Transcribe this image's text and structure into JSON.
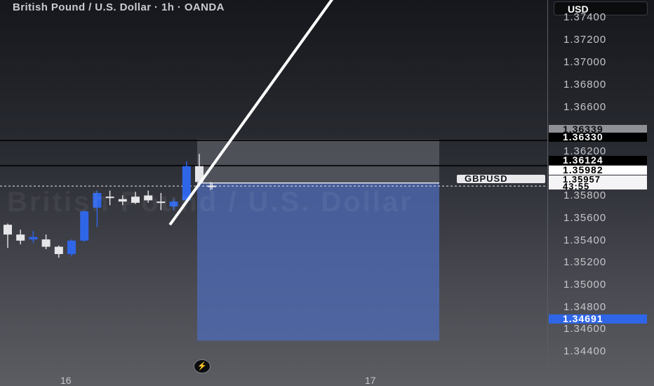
{
  "header": {
    "title": "British Pound / U.S. Dollar · 1h · OANDA",
    "watermark": "British Pound / U.S. Dollar"
  },
  "price_axis": {
    "currency": "USD",
    "ticks": [
      "1.37400",
      "1.37200",
      "1.37000",
      "1.36800",
      "1.36600",
      "1.36200",
      "1.35800",
      "1.35600",
      "1.35400",
      "1.35200",
      "1.35000",
      "1.34800",
      "1.34600",
      "1.34400"
    ],
    "labels": {
      "upper_grey": "1.36339",
      "upper_line": "1.36330",
      "lower_line": "1.36124",
      "entry": "1.35982",
      "last_price": "1.35957",
      "countdown": "43:55",
      "stop_blue": "1.34691"
    },
    "symbol": "GBPUSD"
  },
  "time_axis": {
    "ticks": [
      "16",
      "17"
    ]
  },
  "chart_data": {
    "type": "candlestick",
    "title": "British Pound / U.S. Dollar · 1h · OANDA",
    "symbol": "GBPUSD",
    "currency": "USD",
    "ylim": [
      1.3432,
      1.3748
    ],
    "colors": {
      "up": "#2f66e8",
      "down": "#e6e6e9",
      "line": "#ffffff",
      "short_zone": "#4d6bb8",
      "profit_zone": "#5b5d66"
    },
    "candles": [
      {
        "o": 1.3564,
        "h": 1.3565,
        "l": 1.3545,
        "c": 1.3556
      },
      {
        "o": 1.3556,
        "h": 1.356,
        "l": 1.3548,
        "c": 1.3551
      },
      {
        "o": 1.3552,
        "h": 1.3559,
        "l": 1.3549,
        "c": 1.3554
      },
      {
        "o": 1.3552,
        "h": 1.3556,
        "l": 1.3544,
        "c": 1.3546
      },
      {
        "o": 1.3546,
        "h": 1.3547,
        "l": 1.3537,
        "c": 1.354
      },
      {
        "o": 1.354,
        "h": 1.3552,
        "l": 1.3538,
        "c": 1.3551
      },
      {
        "o": 1.3551,
        "h": 1.3576,
        "l": 1.355,
        "c": 1.3575
      },
      {
        "o": 1.3578,
        "h": 1.3592,
        "l": 1.3562,
        "c": 1.359
      },
      {
        "o": 1.3587,
        "h": 1.3592,
        "l": 1.358,
        "c": 1.3586
      },
      {
        "o": 1.3585,
        "h": 1.3588,
        "l": 1.358,
        "c": 1.3583
      },
      {
        "o": 1.3587,
        "h": 1.3591,
        "l": 1.3581,
        "c": 1.3582
      },
      {
        "o": 1.3588,
        "h": 1.3592,
        "l": 1.3582,
        "c": 1.3584
      },
      {
        "o": 1.3583,
        "h": 1.359,
        "l": 1.3576,
        "c": 1.3582
      },
      {
        "o": 1.3579,
        "h": 1.3585,
        "l": 1.3576,
        "c": 1.3583
      },
      {
        "o": 1.3584,
        "h": 1.3616,
        "l": 1.3582,
        "c": 1.3612
      },
      {
        "o": 1.3612,
        "h": 1.3622,
        "l": 1.3596,
        "c": 1.3599
      },
      {
        "o": 1.3596,
        "h": 1.3598,
        "l": 1.3593,
        "c": 1.35957
      }
    ],
    "levels": [
      1.3633,
      1.36124
    ],
    "last_price": 1.35957,
    "position": {
      "entry": 1.35982,
      "target_top": 1.36339,
      "stop": 1.34691
    },
    "trendline": {
      "from_index": 12.7,
      "from_price": 1.3564,
      "to_index": 25.5,
      "to_price": 1.375
    }
  }
}
